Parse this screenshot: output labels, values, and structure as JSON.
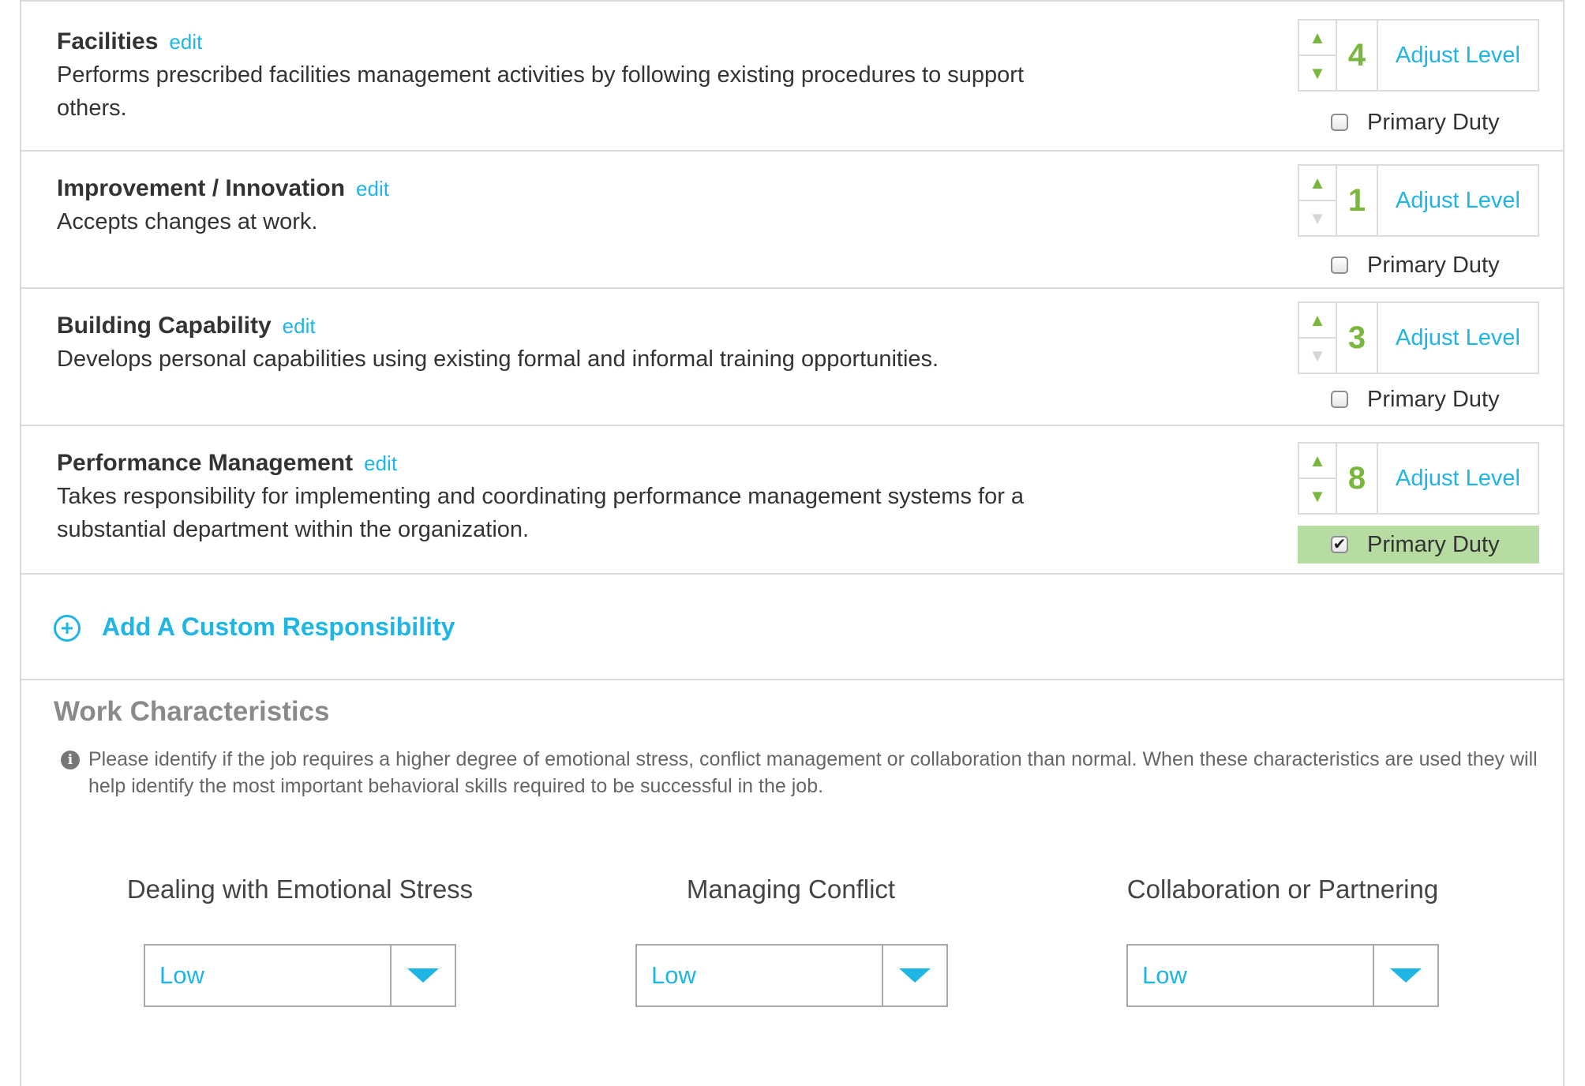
{
  "responsibilities": [
    {
      "title": "Facilities",
      "edit": "edit",
      "description": "Performs prescribed facilities management activities by following existing procedures to support others.",
      "level": "4",
      "up_enabled": true,
      "down_enabled": true,
      "adjust_label": "Adjust Level",
      "primary_label": "Primary Duty",
      "primary_checked": false
    },
    {
      "title": "Improvement / Innovation",
      "edit": "edit",
      "description": "Accepts changes at work.",
      "level": "1",
      "up_enabled": true,
      "down_enabled": false,
      "adjust_label": "Adjust Level",
      "primary_label": "Primary Duty",
      "primary_checked": false
    },
    {
      "title": "Building Capability",
      "edit": "edit",
      "description": "Develops personal capabilities using existing formal and informal training opportunities.",
      "level": "3",
      "up_enabled": true,
      "down_enabled": false,
      "adjust_label": "Adjust Level",
      "primary_label": "Primary Duty",
      "primary_checked": false
    },
    {
      "title": "Performance Management",
      "edit": "edit",
      "description": "Takes responsibility for implementing and coordinating performance management systems for a substantial department within the organization.",
      "level": "8",
      "up_enabled": true,
      "down_enabled": true,
      "adjust_label": "Adjust Level",
      "primary_label": "Primary Duty",
      "primary_checked": true
    }
  ],
  "add_custom": {
    "label": "Add A Custom Responsibility",
    "icon": "plus-circle-icon"
  },
  "work_characteristics": {
    "title": "Work Characteristics",
    "info_icon": "info-icon",
    "info_text": "Please identify if the job requires a higher degree of emotional stress, conflict management or collaboration than normal. When these characteristics are used they will help identify the most important behavioral skills required to be successful in the job.",
    "items": [
      {
        "label": "Dealing with Emotional Stress",
        "value": "Low"
      },
      {
        "label": "Managing Conflict",
        "value": "Low"
      },
      {
        "label": "Collaboration or Partnering",
        "value": "Low"
      }
    ]
  },
  "colors": {
    "accent": "#1fb5e5",
    "level_green": "#79b83d",
    "primary_checked_bg": "#b7dca2"
  }
}
